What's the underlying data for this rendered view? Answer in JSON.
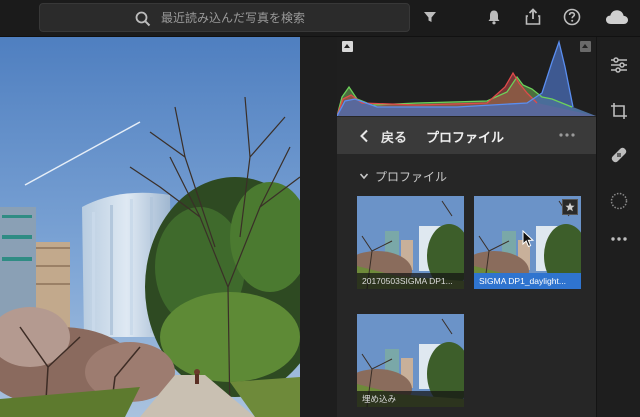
{
  "search": {
    "placeholder": "最近読み込んだ写真を検索"
  },
  "topbar_icons": [
    "search-icon",
    "filter-icon",
    "notification-bell-icon",
    "share-icon",
    "help-icon",
    "cloud-icon"
  ],
  "panel": {
    "header": {
      "back_label": "戻る",
      "title": "プロファイル"
    },
    "section_label": "プロファイル",
    "profiles": [
      {
        "name": "20170503SIGMA DP1...",
        "selected": false
      },
      {
        "name": "SIGMA DP1_daylight...",
        "selected": true
      },
      {
        "name": "埋め込み",
        "selected": false
      }
    ]
  },
  "colors": {
    "accent": "#2f74cf",
    "background": "#1e1e1e",
    "panel": "#262626"
  },
  "tool_strip": [
    "edit-sliders-icon",
    "crop-rotate-icon",
    "healing-brush-icon",
    "radial-filter-icon",
    "more-icon"
  ]
}
